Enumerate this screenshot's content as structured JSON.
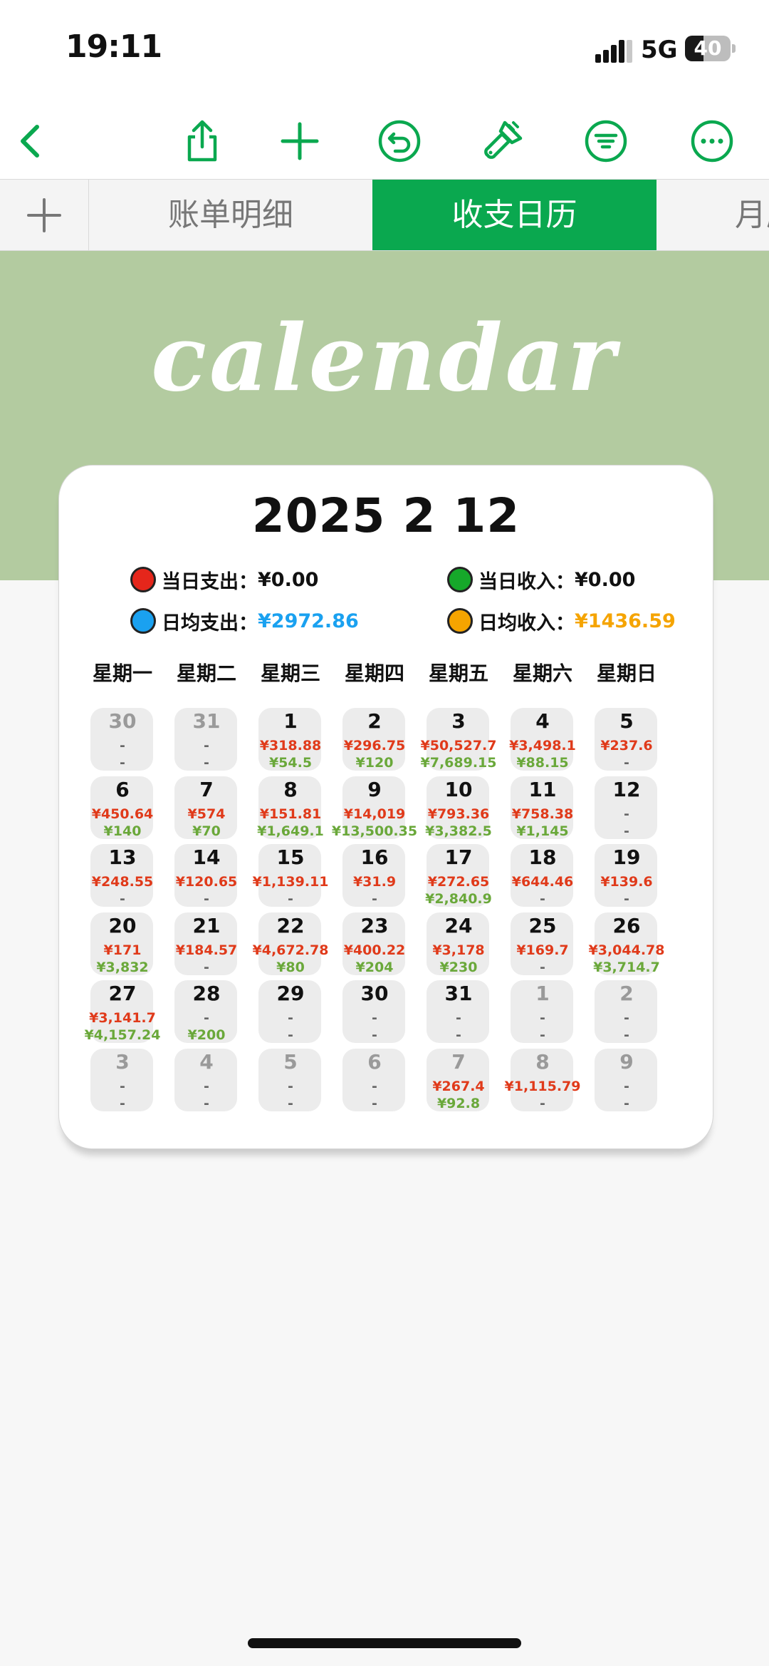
{
  "status_bar": {
    "time": "19:11",
    "network": "5G",
    "battery": "40",
    "battery_level": 0.4
  },
  "toolbar": {
    "icons": [
      "back-chevron-icon",
      "share-icon",
      "plus-icon",
      "undo-icon",
      "brush-icon",
      "filter-icon",
      "more-icon"
    ],
    "accent": "#0aa84f"
  },
  "tabs": [
    {
      "label": "账单明细",
      "active": false
    },
    {
      "label": "收支日历",
      "active": true
    },
    {
      "label": "月历",
      "active": false
    }
  ],
  "banner": {
    "title": "calendar",
    "color": "#b3cba0"
  },
  "calendar": {
    "title": "2025  2  12",
    "stats": {
      "daily_expense_label": "当日支出：",
      "daily_expense_value": "¥0.00",
      "daily_income_label": "当日收入：",
      "daily_income_value": "¥0.00",
      "avg_expense_label": "日均支出：",
      "avg_expense_value": "¥2972.86",
      "avg_income_label": "日均收入：",
      "avg_income_value": "¥1436.59"
    },
    "stat_colors": {
      "expense": "#e5261b",
      "income": "#16a82a",
      "avg_expense": "#1aa1f0",
      "avg_income": "#f5a400"
    },
    "weekdays": [
      "星期一",
      "星期二",
      "星期三",
      "星期四",
      "星期五",
      "星期六",
      "星期日"
    ],
    "days": [
      {
        "num": "30",
        "exp": "-",
        "inc": "-",
        "dim": true
      },
      {
        "num": "31",
        "exp": "-",
        "inc": "-",
        "dim": true
      },
      {
        "num": "1",
        "exp": "¥318.88",
        "inc": "¥54.5",
        "dim": false
      },
      {
        "num": "2",
        "exp": "¥296.75",
        "inc": "¥120",
        "dim": false
      },
      {
        "num": "3",
        "exp": "¥50,527.7",
        "inc": "¥7,689.15",
        "dim": false
      },
      {
        "num": "4",
        "exp": "¥3,498.1",
        "inc": "¥88.15",
        "dim": false
      },
      {
        "num": "5",
        "exp": "¥237.6",
        "inc": "-",
        "dim": false
      },
      {
        "num": "6",
        "exp": "¥450.64",
        "inc": "¥140",
        "dim": false
      },
      {
        "num": "7",
        "exp": "¥574",
        "inc": "¥70",
        "dim": false
      },
      {
        "num": "8",
        "exp": "¥151.81",
        "inc": "¥1,649.1",
        "dim": false
      },
      {
        "num": "9",
        "exp": "¥14,019",
        "inc": "¥13,500.35",
        "dim": false
      },
      {
        "num": "10",
        "exp": "¥793.36",
        "inc": "¥3,382.5",
        "dim": false
      },
      {
        "num": "11",
        "exp": "¥758.38",
        "inc": "¥1,145",
        "dim": false
      },
      {
        "num": "12",
        "exp": "-",
        "inc": "-",
        "dim": false
      },
      {
        "num": "13",
        "exp": "¥248.55",
        "inc": "-",
        "dim": false
      },
      {
        "num": "14",
        "exp": "¥120.65",
        "inc": "-",
        "dim": false
      },
      {
        "num": "15",
        "exp": "¥1,139.11",
        "inc": "-",
        "dim": false
      },
      {
        "num": "16",
        "exp": "¥31.9",
        "inc": "-",
        "dim": false
      },
      {
        "num": "17",
        "exp": "¥272.65",
        "inc": "¥2,840.9",
        "dim": false
      },
      {
        "num": "18",
        "exp": "¥644.46",
        "inc": "-",
        "dim": false
      },
      {
        "num": "19",
        "exp": "¥139.6",
        "inc": "-",
        "dim": false
      },
      {
        "num": "20",
        "exp": "¥171",
        "inc": "¥3,832",
        "dim": false
      },
      {
        "num": "21",
        "exp": "¥184.57",
        "inc": "-",
        "dim": false
      },
      {
        "num": "22",
        "exp": "¥4,672.78",
        "inc": "¥80",
        "dim": false
      },
      {
        "num": "23",
        "exp": "¥400.22",
        "inc": "¥204",
        "dim": false
      },
      {
        "num": "24",
        "exp": "¥3,178",
        "inc": "¥230",
        "dim": false
      },
      {
        "num": "25",
        "exp": "¥169.7",
        "inc": "-",
        "dim": false
      },
      {
        "num": "26",
        "exp": "¥3,044.78",
        "inc": "¥3,714.7",
        "dim": false
      },
      {
        "num": "27",
        "exp": "¥3,141.7",
        "inc": "¥4,157.24",
        "dim": false
      },
      {
        "num": "28",
        "exp": "-",
        "inc": "¥200",
        "dim": false
      },
      {
        "num": "29",
        "exp": "-",
        "inc": "-",
        "dim": false
      },
      {
        "num": "30",
        "exp": "-",
        "inc": "-",
        "dim": false
      },
      {
        "num": "31",
        "exp": "-",
        "inc": "-",
        "dim": false
      },
      {
        "num": "1",
        "exp": "-",
        "inc": "-",
        "dim": true
      },
      {
        "num": "2",
        "exp": "-",
        "inc": "-",
        "dim": true
      },
      {
        "num": "3",
        "exp": "-",
        "inc": "-",
        "dim": true
      },
      {
        "num": "4",
        "exp": "-",
        "inc": "-",
        "dim": true
      },
      {
        "num": "5",
        "exp": "-",
        "inc": "-",
        "dim": true
      },
      {
        "num": "6",
        "exp": "-",
        "inc": "-",
        "dim": true
      },
      {
        "num": "7",
        "exp": "¥267.4",
        "inc": "¥92.8",
        "dim": true
      },
      {
        "num": "8",
        "exp": "¥1,115.79",
        "inc": "-",
        "dim": true
      },
      {
        "num": "9",
        "exp": "-",
        "inc": "-",
        "dim": true
      }
    ]
  }
}
